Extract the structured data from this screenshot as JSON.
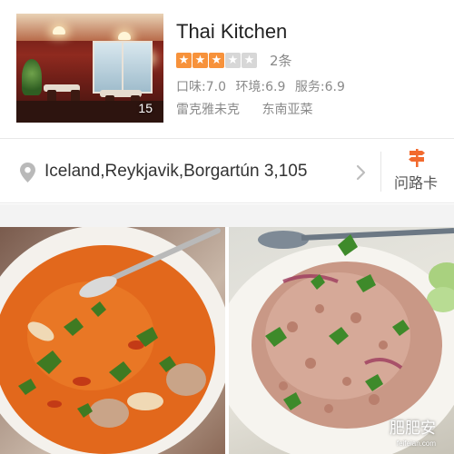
{
  "listing": {
    "title": "Thai Kitchen",
    "rating": 3,
    "rating_max": 5,
    "star_on_color": "#f7923b",
    "star_off_color": "#d7d7d7",
    "review_count": "2条",
    "photo_count": "15",
    "scores": {
      "taste": "口味:7.0",
      "environment": "环境:6.9",
      "service": "服务:6.9"
    },
    "tags": [
      "雷克雅未克",
      "东南亚菜"
    ]
  },
  "address_row": {
    "address": "Iceland,Reykjavik,Borgartún 3,105",
    "pin_icon": "location-pin-icon",
    "chevron_icon": "chevron-right-icon",
    "route_card_label": "问路卡",
    "route_card_icon": "signpost-icon",
    "accent_color": "#f26a2e"
  },
  "photos": {
    "left_alt": "tom-yum-soup-photo",
    "right_alt": "larb-salad-photo",
    "watermark": "肥肥安",
    "watermark_sub": "feifeian.com"
  }
}
